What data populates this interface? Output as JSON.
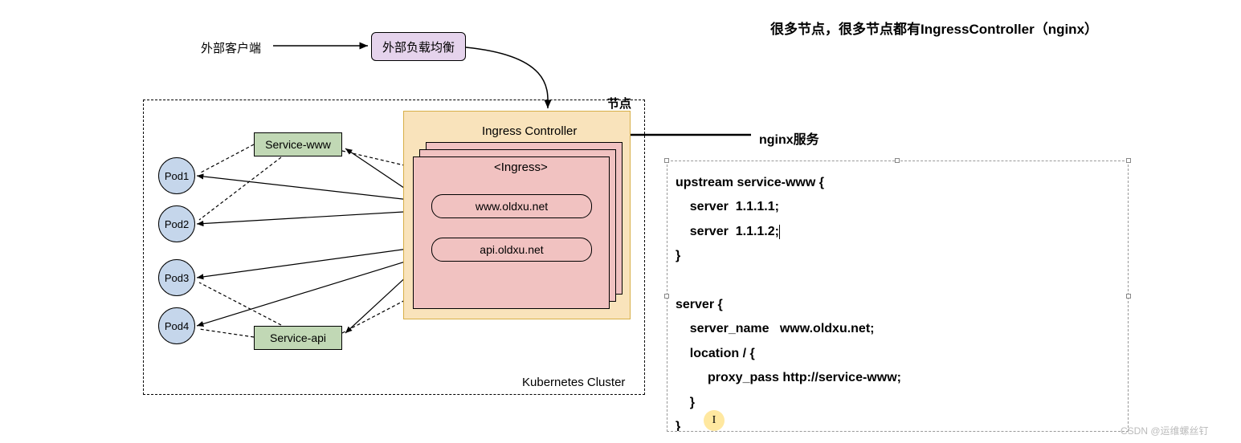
{
  "topNote": "很多节点，很多节点都有IngressController（nginx）",
  "clientLabel": "外部客户端",
  "loadBalancer": "外部负载均衡",
  "nodeLabel": "节点",
  "controllerLabel": "Ingress Controller",
  "ingressTitle": "<Ingress>",
  "routes": {
    "www": "www.oldxu.net",
    "api": "api.oldxu.net"
  },
  "services": {
    "www": "Service-www",
    "api": "Service-api"
  },
  "pods": {
    "p1": "Pod1",
    "p2": "Pod2",
    "p3": "Pod3",
    "p4": "Pod4"
  },
  "clusterLabel": "Kubernetes Cluster",
  "nginxServiceLabel": "nginx服务",
  "code": {
    "l1": "upstream service-www {",
    "l2": "    server  1.1.1.1;",
    "l3": "    server  1.1.1.2;",
    "l4": "}",
    "l5": "",
    "l6": "server {",
    "l7": "    server_name   www.oldxu.net;",
    "l8": "    location / {",
    "l9": "         proxy_pass http://service-www;",
    "l10": "    }",
    "l11": "}"
  },
  "watermark": "CSDN @运维螺丝钉"
}
